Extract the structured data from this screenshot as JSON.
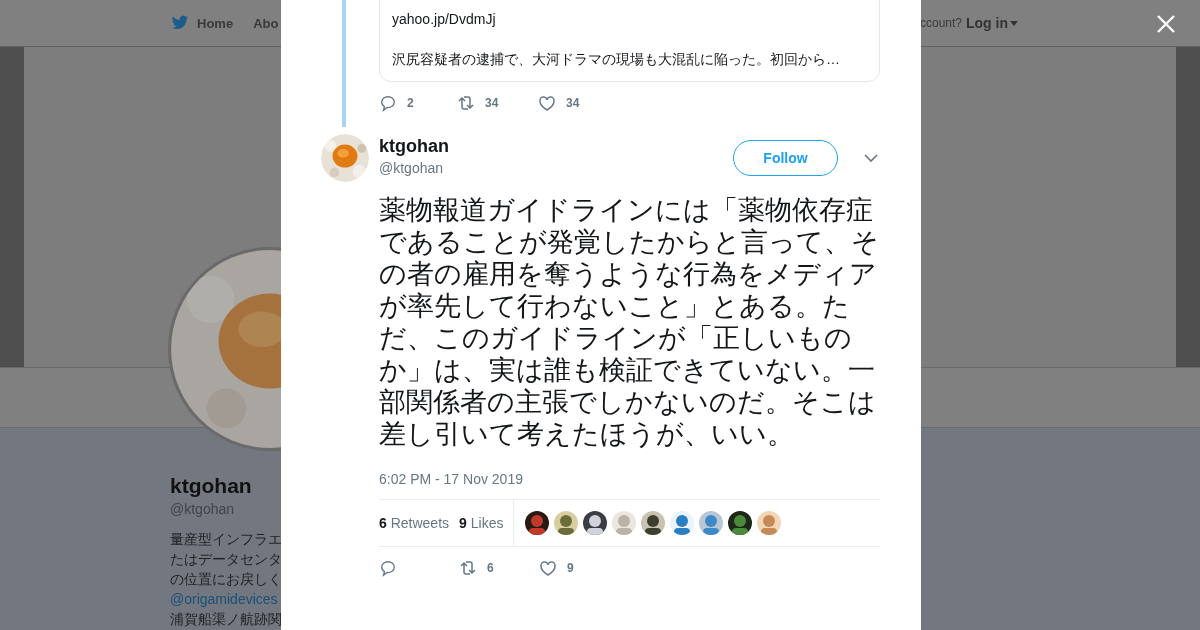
{
  "background_page": {
    "nav": {
      "items": [
        "Home",
        "Abo"
      ],
      "account_prompt": "ccount?",
      "login": "Log in"
    },
    "profile": {
      "name": "ktgohan",
      "handle": "@ktgohan",
      "bio_lines": [
        "量産型インフラエ",
        "たはデータセンタ",
        "の位置にお戻しく"
      ],
      "mention": "@origamidevices",
      "bio_last": "浦賀船渠ノ航跡関"
    }
  },
  "modal": {
    "quoted_tweet": {
      "link": "yahoo.jp/DvdmJj",
      "summary": "沢尻容疑者の逮捕で、大河ドラマの現場も大混乱に陥った。初回から…",
      "replies": "2",
      "retweets": "34",
      "likes": "34"
    },
    "tweet": {
      "name": "ktgohan",
      "handle": "@ktgohan",
      "follow": "Follow",
      "text": "薬物報道ガイドラインには「薬物依存症であることが発覚したからと言って、その者の雇用を奪うような行為をメディアが率先して行わないこと」とある。ただ、このガイドラインが「正しいものか」は、実は誰も検証できていない。一部関係者の主張でしかないのだ。そこは差し引いて考えたほうが、いい。",
      "time": "6:02 PM - 17 Nov 2019",
      "retweet_count": "6",
      "retweet_label": "Retweets",
      "like_count": "9",
      "like_label": "Likes",
      "action_retweets": "6",
      "action_likes": "9"
    }
  }
}
